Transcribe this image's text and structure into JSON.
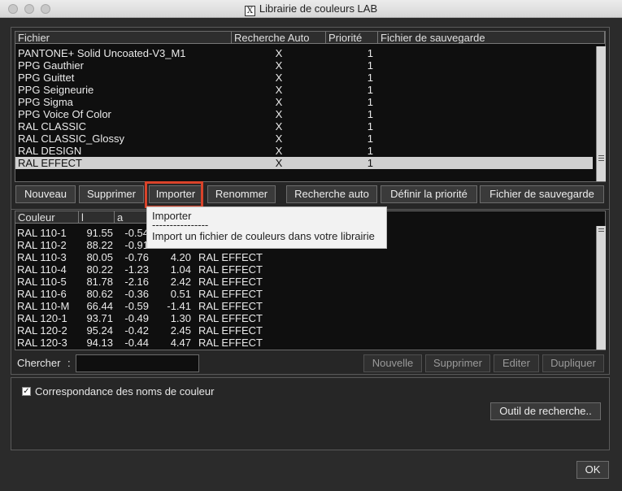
{
  "window": {
    "title": "Librairie de couleurs LAB",
    "x_icon_glyph": "X"
  },
  "library_table": {
    "headers": [
      "Fichier",
      "Recherche Auto",
      "Priorité",
      "Fichier de sauvegarde"
    ],
    "rows": [
      {
        "file": "PANTONE+ Solid Uncoated-V3_M1",
        "auto": "X",
        "priority": "1",
        "backup": ""
      },
      {
        "file": "PPG Gauthier",
        "auto": "X",
        "priority": "1",
        "backup": ""
      },
      {
        "file": "PPG Guittet",
        "auto": "X",
        "priority": "1",
        "backup": ""
      },
      {
        "file": "PPG Seigneurie",
        "auto": "X",
        "priority": "1",
        "backup": ""
      },
      {
        "file": "PPG Sigma",
        "auto": "X",
        "priority": "1",
        "backup": ""
      },
      {
        "file": "PPG Voice Of Color",
        "auto": "X",
        "priority": "1",
        "backup": ""
      },
      {
        "file": "RAL CLASSIC",
        "auto": "X",
        "priority": "1",
        "backup": ""
      },
      {
        "file": "RAL CLASSIC_Glossy",
        "auto": "X",
        "priority": "1",
        "backup": ""
      },
      {
        "file": "RAL DESIGN",
        "auto": "X",
        "priority": "1",
        "backup": ""
      },
      {
        "file": "RAL EFFECT",
        "auto": "X",
        "priority": "1",
        "backup": ""
      }
    ],
    "selected_row": "RAL EFFECT"
  },
  "library_buttons": {
    "new": "Nouveau",
    "delete": "Supprimer",
    "import": "Importer",
    "rename": "Renommer",
    "auto_search": "Recherche auto",
    "set_priority": "Définir la priorité",
    "backup_file": "Fichier de sauvegarde"
  },
  "tooltip": {
    "title": "Importer",
    "separator": "----------------",
    "description": "Import un fichier de couleurs dans votre librairie"
  },
  "color_table": {
    "headers": [
      "Couleur",
      "l",
      "a"
    ],
    "rows": [
      {
        "name": "RAL 110-1",
        "l": "91.55",
        "a": "-0.54",
        "b": "",
        "lib": ""
      },
      {
        "name": "RAL 110-2",
        "l": "88.22",
        "a": "-0.91",
        "b": "",
        "lib": ""
      },
      {
        "name": "RAL 110-3",
        "l": "80.05",
        "a": "-0.76",
        "b": "4.20",
        "lib": "RAL EFFECT"
      },
      {
        "name": "RAL 110-4",
        "l": "80.22",
        "a": "-1.23",
        "b": "1.04",
        "lib": "RAL EFFECT"
      },
      {
        "name": "RAL 110-5",
        "l": "81.78",
        "a": "-2.16",
        "b": "2.42",
        "lib": "RAL EFFECT"
      },
      {
        "name": "RAL 110-6",
        "l": "80.62",
        "a": "-0.36",
        "b": "0.51",
        "lib": "RAL EFFECT"
      },
      {
        "name": "RAL 110-M",
        "l": "66.44",
        "a": "-0.59",
        "b": "-1.41",
        "lib": "RAL EFFECT"
      },
      {
        "name": "RAL 120-1",
        "l": "93.71",
        "a": "-0.49",
        "b": "1.30",
        "lib": "RAL EFFECT"
      },
      {
        "name": "RAL 120-2",
        "l": "95.24",
        "a": "-0.42",
        "b": "2.45",
        "lib": "RAL EFFECT"
      },
      {
        "name": "RAL 120-3",
        "l": "94.13",
        "a": "-0.44",
        "b": "4.47",
        "lib": "RAL EFFECT"
      }
    ]
  },
  "search_bar": {
    "label": "Chercher",
    "colon": ":",
    "value": "",
    "new": "Nouvelle",
    "delete": "Supprimer",
    "edit": "Editer",
    "duplicate": "Dupliquer"
  },
  "options": {
    "match_names_label": "Correspondance des noms de couleur",
    "match_names_checked": true,
    "check_glyph": "✓",
    "search_tool": "Outil de recherche.."
  },
  "ok_button": "OK",
  "colors": {
    "highlight": "#d9432a",
    "window_bg": "#2b2b2b",
    "list_bg": "#0f0f0f",
    "selection": "#d0d0d0"
  }
}
